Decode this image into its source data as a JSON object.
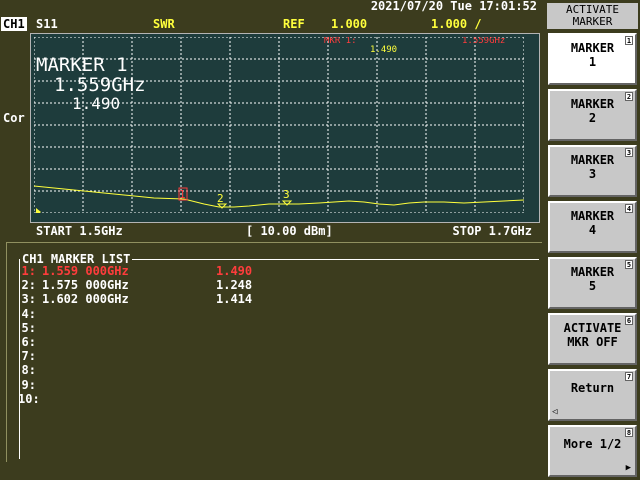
{
  "header": {
    "datetime": "2021/07/20 Tue 17:01:52",
    "channel": "CH1",
    "measurement": "S11",
    "format": "SWR",
    "ref_label": "REF",
    "ref_value": "1.000",
    "scale_value": "1.000 /",
    "side_label": "Cor"
  },
  "trace": {
    "active_marker_title": "MARKER 1",
    "active_marker_freq": "1.559GHz",
    "active_marker_value": "1.490",
    "mkr_label": "MKR 1:",
    "mkr_value": "1.490",
    "mkr_freq": "1.559GHz",
    "marker_labels": [
      "1",
      "2",
      "3"
    ],
    "colors": {
      "trace": "#ffff3c",
      "active": "#ff3c3c",
      "grid": "#ffffff",
      "background": "#1e3c3c"
    }
  },
  "status": {
    "start": "START 1.5GHz",
    "range": "[ 10.00 dBm]",
    "stop": "STOP 1.7GHz"
  },
  "marker_list": {
    "title": "CH1 MARKER LIST",
    "rows": [
      {
        "num": "1:",
        "freq": "1.559 000GHz",
        "value": "1.490",
        "active": true
      },
      {
        "num": "2:",
        "freq": "1.575 000GHz",
        "value": "1.248",
        "active": false
      },
      {
        "num": "3:",
        "freq": "1.602 000GHz",
        "value": "1.414",
        "active": false
      },
      {
        "num": "4:",
        "freq": "",
        "value": "",
        "active": false
      },
      {
        "num": "5:",
        "freq": "",
        "value": "",
        "active": false
      },
      {
        "num": "6:",
        "freq": "",
        "value": "",
        "active": false
      },
      {
        "num": "7:",
        "freq": "",
        "value": "",
        "active": false
      },
      {
        "num": "8:",
        "freq": "",
        "value": "",
        "active": false
      },
      {
        "num": "9:",
        "freq": "",
        "value": "",
        "active": false
      },
      {
        "num": "10:",
        "freq": "",
        "value": "",
        "active": false
      }
    ]
  },
  "softkeys": {
    "title_line1": "ACTIVATE",
    "title_line2": "MARKER",
    "keys": [
      {
        "line1": "MARKER",
        "line2": "1",
        "num": "1",
        "active": true
      },
      {
        "line1": "MARKER",
        "line2": "2",
        "num": "2",
        "active": false
      },
      {
        "line1": "MARKER",
        "line2": "3",
        "num": "3",
        "active": false
      },
      {
        "line1": "MARKER",
        "line2": "4",
        "num": "4",
        "active": false
      },
      {
        "line1": "MARKER",
        "line2": "5",
        "num": "5",
        "active": false
      },
      {
        "line1": "ACTIVATE",
        "line2": "MKR OFF",
        "num": "6",
        "active": false
      },
      {
        "line1": "Return",
        "line2": "",
        "num": "7",
        "active": false
      },
      {
        "line1": "More 1/2",
        "line2": "",
        "num": "8",
        "active": false
      }
    ]
  }
}
